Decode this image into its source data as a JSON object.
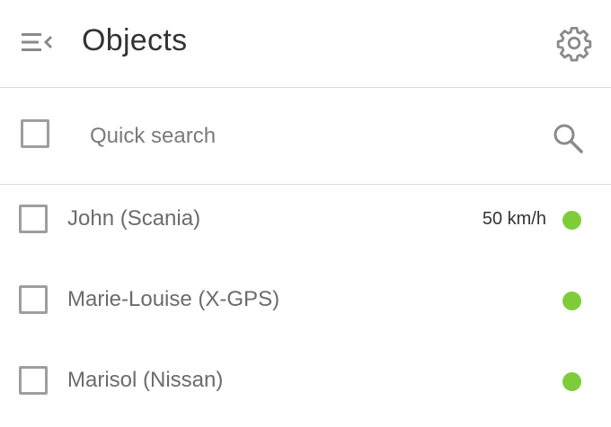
{
  "header": {
    "title": "Objects",
    "menu_icon": "menu-collapse-icon",
    "settings_icon": "gear-icon"
  },
  "search": {
    "placeholder": "Quick search",
    "value": "",
    "icon": "search-icon"
  },
  "objects": [
    {
      "name": "John (Scania)",
      "speed": "50 km/h",
      "status_color": "#7fcc3a",
      "checked": false
    },
    {
      "name": "Marie-Louise (X-GPS)",
      "speed": "",
      "status_color": "#7fcc3a",
      "checked": false
    },
    {
      "name": "Marisol (Nissan)",
      "speed": "",
      "status_color": "#7fcc3a",
      "checked": false
    }
  ],
  "colors": {
    "status_online": "#7fcc3a",
    "icon_gray": "#8a8a8a",
    "divider": "#dcdcdc"
  }
}
